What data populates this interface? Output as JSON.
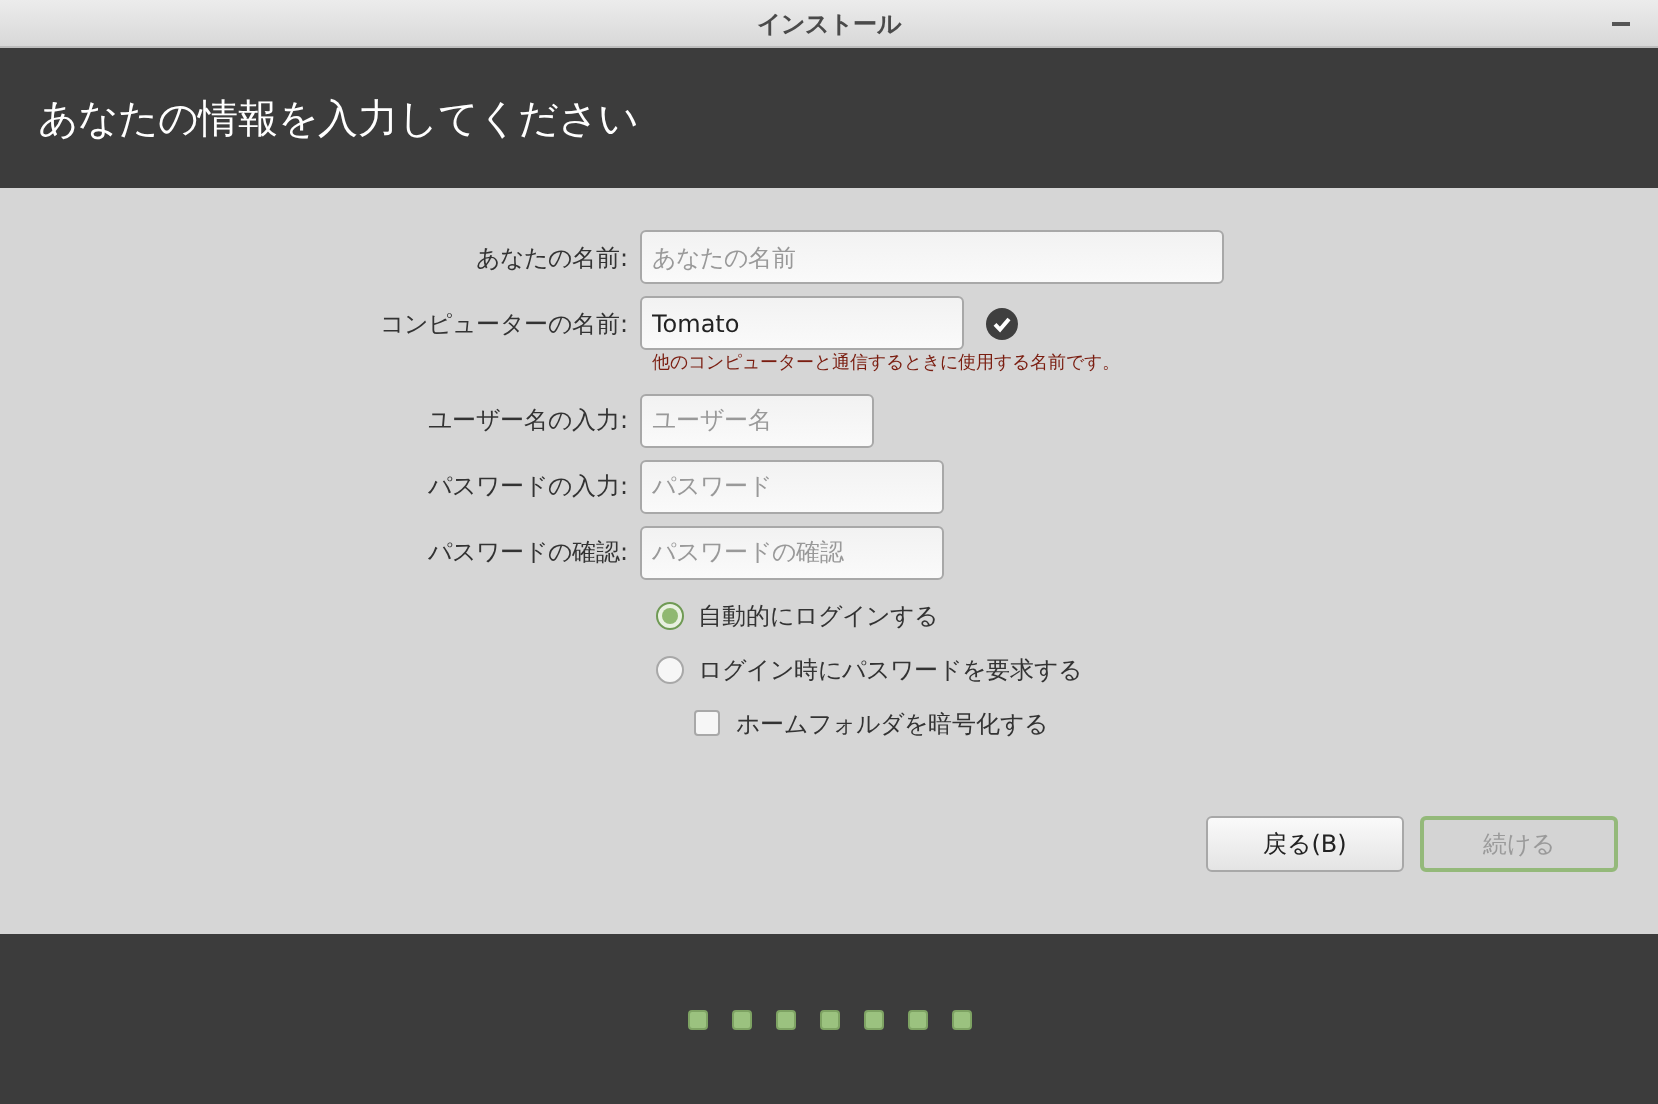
{
  "window": {
    "title": "インストール"
  },
  "header": {
    "title": "あなたの情報を入力してください"
  },
  "fields": [
    {
      "label": "あなたの名前:",
      "placeholder": "あなたの名前",
      "valid": false
    },
    {
      "label": "コンピューターの名前:",
      "value": "Tomato",
      "valid": true,
      "hint": "他のコンピューターと通信するときに使用する名前です。"
    },
    {
      "label": "ユーザー名の入力:",
      "placeholder": "ユーザー名",
      "valid": false
    },
    {
      "label": "パスワードの入力:",
      "placeholder": "パスワード",
      "valid": false
    },
    {
      "label": "パスワードの確認:",
      "placeholder": "パスワードの確認",
      "valid": false
    }
  ],
  "login_options": [
    {
      "label": "自動的にログインする",
      "selected": true
    },
    {
      "label": "ログイン時にパスワードを要求する",
      "selected": false
    }
  ],
  "encrypt": {
    "label": "ホームフォルダを暗号化する",
    "checked": false
  },
  "buttons": [
    {
      "label": "戻る(B)",
      "disabled": false
    },
    {
      "label": "続ける",
      "disabled": true
    }
  ],
  "progress_dots": [
    {
      "done": true
    },
    {
      "done": true
    },
    {
      "done": true
    },
    {
      "done": true
    },
    {
      "done": true
    },
    {
      "done": true
    },
    {
      "done": true
    }
  ]
}
